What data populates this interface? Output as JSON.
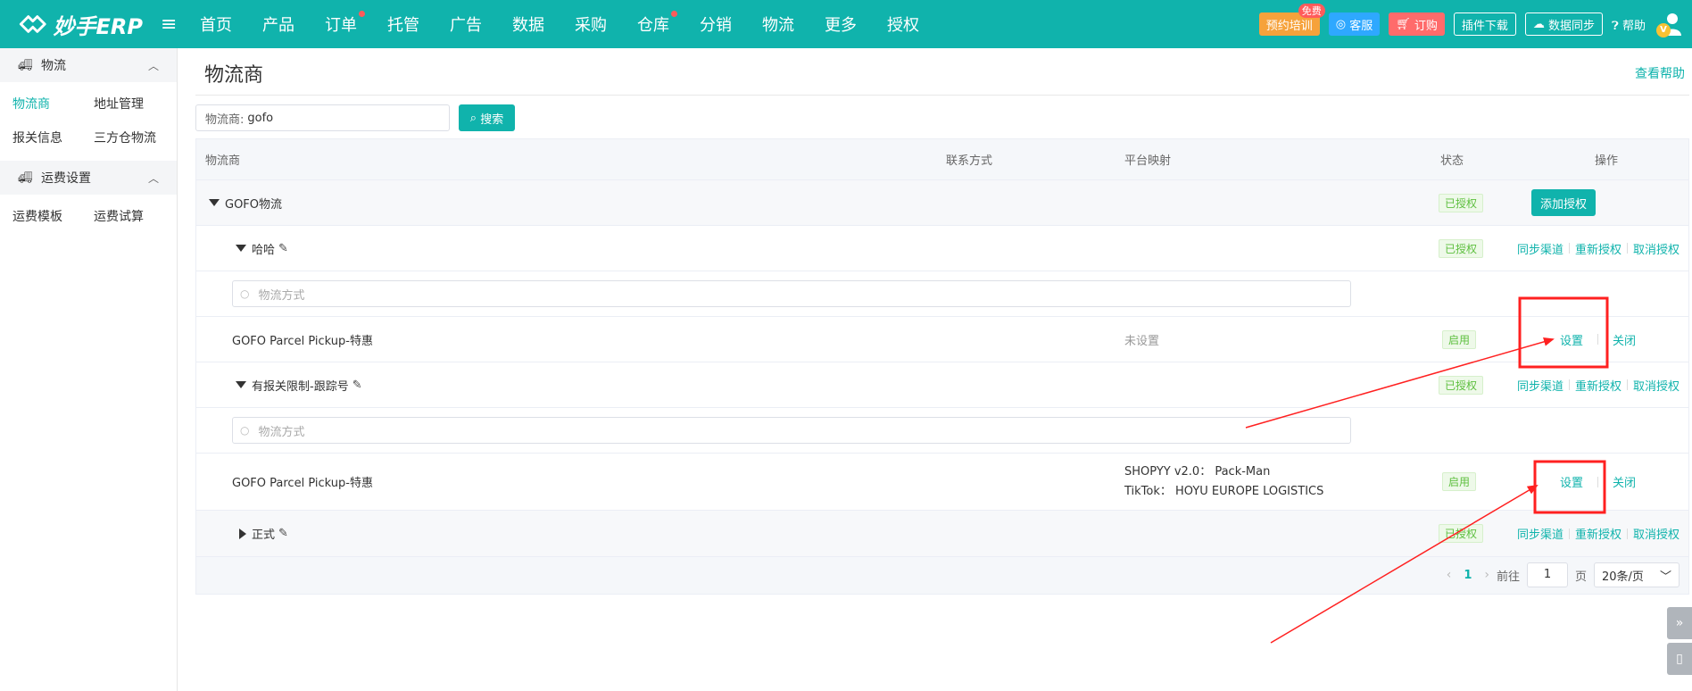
{
  "header": {
    "logo_text": "妙手ERP",
    "nav": [
      {
        "label": "首页",
        "dot": false
      },
      {
        "label": "产品",
        "dot": false
      },
      {
        "label": "订单",
        "dot": true
      },
      {
        "label": "托管",
        "dot": false
      },
      {
        "label": "广告",
        "dot": false
      },
      {
        "label": "数据",
        "dot": false
      },
      {
        "label": "采购",
        "dot": false
      },
      {
        "label": "仓库",
        "dot": true
      },
      {
        "label": "分销",
        "dot": false
      },
      {
        "label": "物流",
        "dot": false
      },
      {
        "label": "更多",
        "dot": false
      },
      {
        "label": "授权",
        "dot": false
      }
    ],
    "training_label": "预约培训",
    "free_tag": "免费",
    "service_label": "客服",
    "order_label": "订购",
    "plugin_label": "插件下载",
    "sync_label": "数据同步",
    "help_label": "帮助",
    "avatar_badge": "V"
  },
  "sidebar": {
    "groups": [
      {
        "label": "物流",
        "items": [
          "物流商",
          "地址管理",
          "报关信息",
          "三方仓物流"
        ],
        "active": 0
      },
      {
        "label": "运费设置",
        "items": [
          "运费模板",
          "运费试算"
        ],
        "active": -1
      }
    ]
  },
  "page": {
    "title": "物流商",
    "help_link": "查看帮助",
    "search_label": "物流商:",
    "search_value": "gofo",
    "search_button": "搜索"
  },
  "table": {
    "columns": [
      "物流商",
      "联系方式",
      "平台映射",
      "状态",
      "操作"
    ],
    "provider": {
      "name": "GOFO物流",
      "status": "已授权",
      "action": "添加授权"
    },
    "accounts": [
      {
        "name": "哈哈",
        "status": "已授权",
        "actions": [
          "同步渠道",
          "重新授权",
          "取消授权"
        ],
        "search_placeholder": "物流方式",
        "method": {
          "name": "GOFO Parcel Pickup-特惠",
          "mapping": [
            "未设置"
          ],
          "status": "启用",
          "actions": [
            "设置",
            "关闭"
          ]
        }
      },
      {
        "name": "有报关限制-跟踪号",
        "status": "已授权",
        "actions": [
          "同步渠道",
          "重新授权",
          "取消授权"
        ],
        "search_placeholder": "物流方式",
        "method": {
          "name": "GOFO Parcel Pickup-特惠",
          "mapping": [
            "SHOPYY v2.0： Pack-Man",
            "TikTok： HOYU EUROPE LOGISTICS"
          ],
          "status": "启用",
          "actions": [
            "设置",
            "关闭"
          ]
        }
      },
      {
        "name": "正式",
        "status": "已授权",
        "actions": [
          "同步渠道",
          "重新授权",
          "取消授权"
        ]
      }
    ]
  },
  "pager": {
    "current_page": "1",
    "goto_label": "前往",
    "goto_value": "1",
    "page_unit": "页",
    "page_size": "20条/页"
  },
  "colors": {
    "brand": "#10b3ac",
    "annotation": "#ff2020",
    "enabled": "#5dbf3e"
  }
}
